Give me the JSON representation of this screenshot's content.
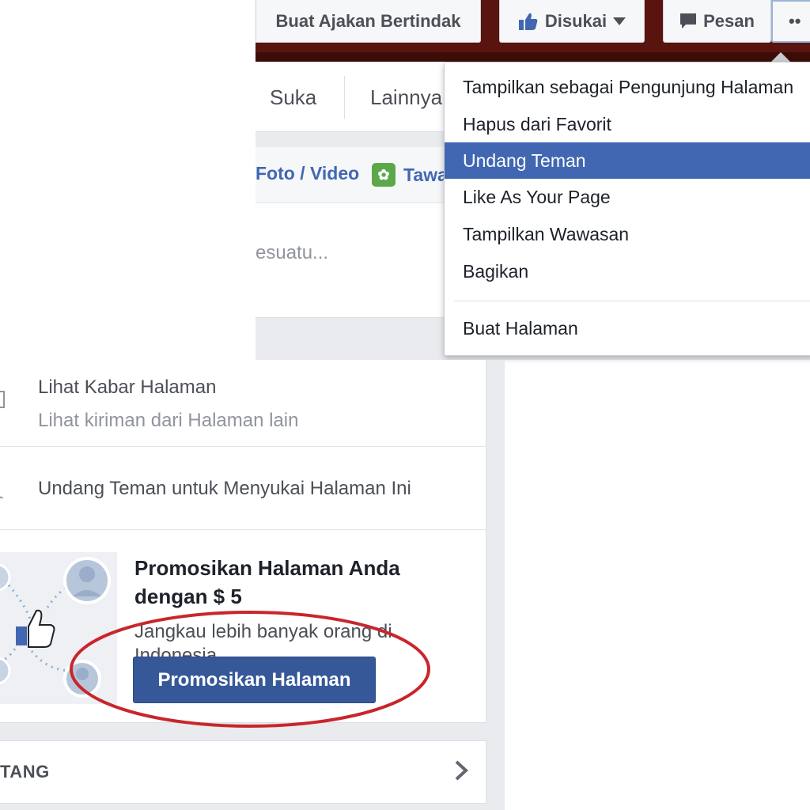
{
  "cover": {
    "cta_button": "Buat Ajakan Bertindak",
    "liked_button": "Disukai",
    "message_button": "Pesan",
    "more_button": "••"
  },
  "page_tabs": {
    "likes": "Suka",
    "more": "Lainnya"
  },
  "composer": {
    "photo_video": "Foto / Video",
    "offer": "Tawa",
    "placeholder": "esuatu..."
  },
  "dropdown": {
    "items": [
      {
        "label": "Tampilkan sebagai Pengunjung Halaman"
      },
      {
        "label": "Hapus dari Favorit"
      },
      {
        "label": "Undang Teman",
        "active": true
      },
      {
        "label": "Like As Your Page"
      },
      {
        "label": "Tampilkan Wawasan"
      },
      {
        "label": "Bagikan"
      },
      {
        "label": "Buat Halaman"
      }
    ]
  },
  "sidebar": {
    "page_feed_title": "Lihat Kabar Halaman",
    "page_feed_subtitle": "Lihat kiriman dari Halaman lain",
    "invite_friends": "Undang Teman untuk Menyukai Halaman Ini",
    "promo": {
      "title": "Promosikan Halaman Anda dengan $ 5",
      "description": "Jangkau lebih banyak orang di Indonesia",
      "button": "Promosikan Halaman"
    },
    "about_label": "TANG"
  },
  "colors": {
    "facebook_blue": "#4267b2",
    "promo_button": "#365899",
    "highlight_ring": "#c8262c",
    "cover_maroon": "#5a1410"
  }
}
